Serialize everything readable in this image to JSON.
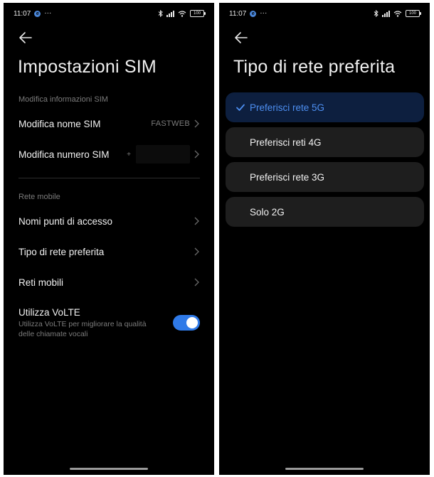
{
  "status_bar": {
    "time": "11:07",
    "app_badge": "e",
    "dots": "···",
    "battery": "100"
  },
  "left": {
    "title": "Impostazioni SIM",
    "section1_label": "Modifica informazioni SIM",
    "sim_name": {
      "label": "Modifica nome SIM",
      "value": "FASTWEB"
    },
    "sim_number": {
      "label": "Modifica numero SIM",
      "prefix": "+"
    },
    "section2_label": "Rete mobile",
    "items": [
      {
        "label": "Nomi punti di accesso"
      },
      {
        "label": "Tipo di rete preferita"
      },
      {
        "label": "Reti mobili"
      }
    ],
    "volte": {
      "title": "Utilizza VoLTE",
      "description": "Utilizza VoLTE per migliorare la qualità delle chiamate vocali",
      "enabled": true
    }
  },
  "right": {
    "title": "Tipo di rete preferita",
    "options": [
      {
        "label": "Preferisci rete 5G",
        "selected": true
      },
      {
        "label": "Preferisci reti 4G",
        "selected": false
      },
      {
        "label": "Preferisci rete 3G",
        "selected": false
      },
      {
        "label": "Solo 2G",
        "selected": false
      }
    ]
  },
  "colors": {
    "accent": "#2f7ae8",
    "selected_text": "#4d8ff2",
    "selected_bg": "#0d1f3f",
    "card_bg": "#1e1e1e"
  }
}
